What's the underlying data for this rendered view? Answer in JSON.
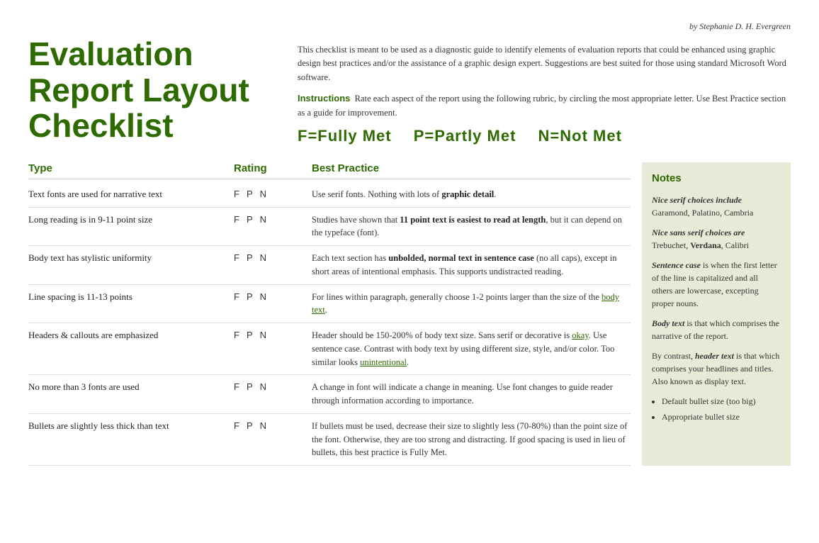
{
  "byline": "by Stephanie D. H. Evergreen",
  "title": "Evaluation Report Layout Checklist",
  "intro": "This checklist is meant to be used as a diagnostic guide to identify elements of evaluation reports that could be enhanced using graphic design best practices and/or the assistance of a graphic design expert. Suggestions are best suited for those using standard Microsoft Word software.",
  "instructions_label": "Instructions",
  "instructions_text": "Rate each aspect of the report using the following rubric, by circling the most appropriate letter. Use Best Practice section as a guide for improvement.",
  "rubric": {
    "f": "F=Fully Met",
    "p": "P=Partly Met",
    "n": "N=Not Met"
  },
  "columns": {
    "type": "Type",
    "rating": "Rating",
    "best_practice": "Best Practice"
  },
  "rows": [
    {
      "type": "Text fonts are used for narrative text",
      "rating": [
        "F",
        "P",
        "N"
      ],
      "bp": "Use serif fonts. Nothing with lots of graphic detail."
    },
    {
      "type": "Long reading is in 9-11 point size",
      "rating": [
        "F",
        "P",
        "N"
      ],
      "bp": "Studies have shown that 11 point text is easiest to read at length, but it can depend on the typeface (font)."
    },
    {
      "type": "Body text has stylistic uniformity",
      "rating": [
        "F",
        "P",
        "N"
      ],
      "bp": "Each text section has unbolded, normal text in sentence case (no all caps), except in short areas of intentional emphasis. This supports undistracted reading."
    },
    {
      "type": "Line spacing is 11-13 points",
      "rating": [
        "F",
        "P",
        "N"
      ],
      "bp": "For lines within paragraph, generally choose 1-2 points larger than the size of the body text."
    },
    {
      "type": "Headers & callouts are emphasized",
      "rating": [
        "F",
        "P",
        "N"
      ],
      "bp": "Header should be 150-200% of body text size. Sans serif or decorative is okay. Use sentence case. Contrast with body text by using different size, style, and/or color. Too similar looks unintentional."
    },
    {
      "type": "No more than 3 fonts are used",
      "rating": [
        "F",
        "P",
        "N"
      ],
      "bp": "A change in font will indicate a change in meaning. Use font changes to guide reader through information according to importance."
    },
    {
      "type": "Bullets are slightly less thick than text",
      "rating": [
        "F",
        "P",
        "N"
      ],
      "bp": "If bullets must be used, decrease their size to slightly less (70-80%) than the point size of the font. Otherwise, they are too strong and distracting. If good spacing is used in lieu of bullets, this best practice is Fully Met."
    }
  ],
  "notes": {
    "title": "Notes",
    "items": [
      {
        "label": "Nice serif choices include",
        "text": "Garamond, Palatino, Cambria"
      },
      {
        "label": "Nice sans serif choices are",
        "text": "Trebuchet, Verdana, Calibri"
      },
      {
        "label": "Sentence case",
        "text": "is when the first letter of the line is capitalized and all others are lowercase, excepting proper nouns."
      },
      {
        "label": "Body text",
        "text": "is that which comprises the narrative of the report."
      },
      {
        "label_prefix": "By contrast, ",
        "label": "header text",
        "text": "is that which comprises your headlines and titles. Also known as display text."
      },
      {
        "bullets": [
          "Default bullet size (too big)",
          "Appropriate bullet size"
        ]
      }
    ]
  }
}
